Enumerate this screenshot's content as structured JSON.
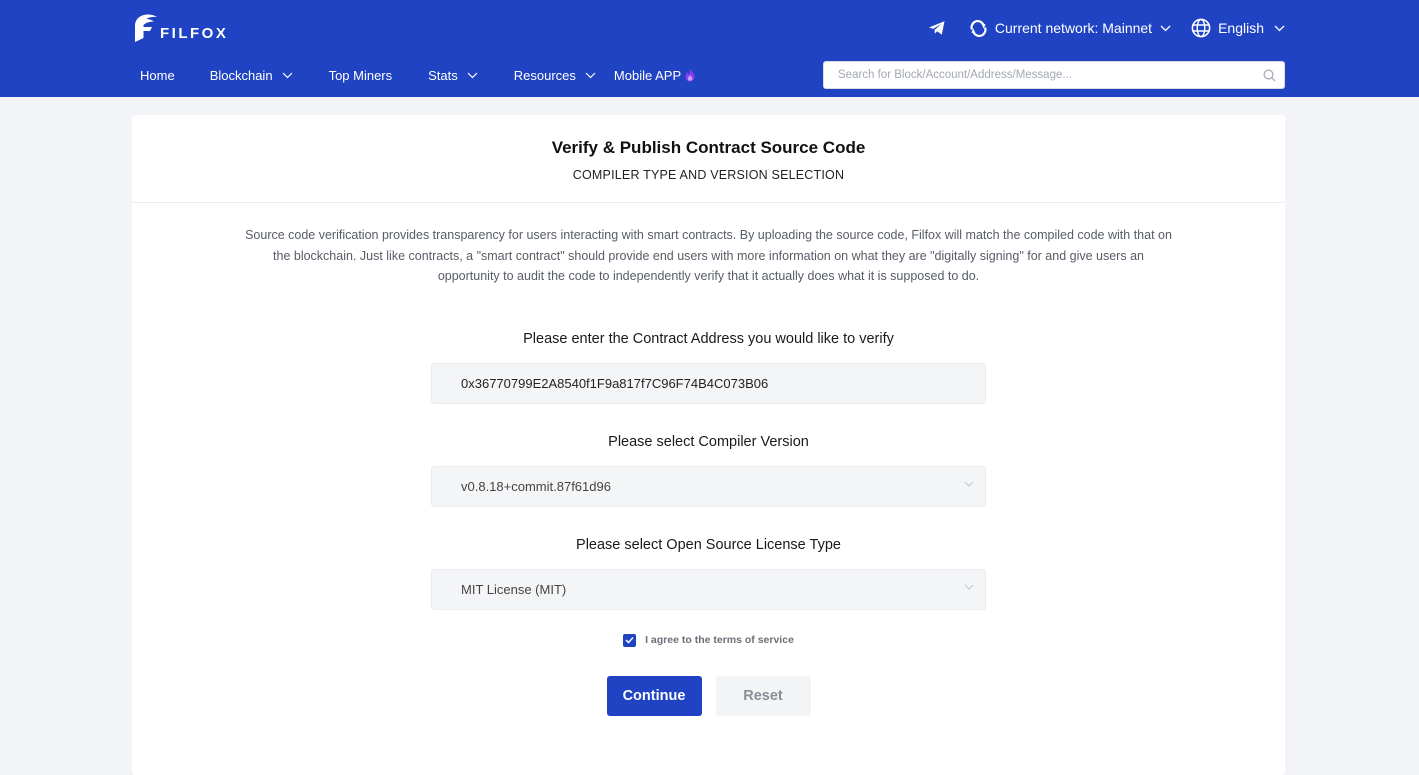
{
  "brand": {
    "name": "FILFOX",
    "logo_icon": "filfox-logo-icon"
  },
  "colors": {
    "header": "#1f43c2",
    "accent": "#1f43c2",
    "page_bg": "#f2f4f7"
  },
  "topbar": {
    "telegram_icon": "telegram-icon",
    "network_label": "Current network: Mainnet",
    "language_label": "English"
  },
  "nav": {
    "home": "Home",
    "blockchain": "Blockchain",
    "top_miners": "Top Miners",
    "stats": "Stats",
    "resources": "Resources",
    "mobile_app": "Mobile APP"
  },
  "search": {
    "placeholder": "Search for Block/Account/Address/Message..."
  },
  "page": {
    "title": "Verify & Publish Contract Source Code",
    "subtitle": "COMPILER TYPE AND VERSION SELECTION",
    "description": "Source code verification provides transparency for users interacting with smart contracts. By uploading the source code, Filfox will match the compiled code with that on the blockchain. Just like contracts, a \"smart contract\" should provide end users with more information on what they are \"digitally signing\" for and give users an opportunity to audit the code to independently verify that it actually does what it is supposed to do."
  },
  "form": {
    "address_label": "Please enter the Contract Address you would like to verify",
    "address_value": "0x36770799E2A8540f1F9a817f7C96F74B4C073B06",
    "compiler_label": "Please select Compiler Version",
    "compiler_value": "v0.8.18+commit.87f61d96",
    "license_label": "Please select Open Source License Type",
    "license_value": "MIT License (MIT)",
    "agree_label": "I agree to the terms of service",
    "agree_checked": true,
    "continue_label": "Continue",
    "reset_label": "Reset"
  }
}
